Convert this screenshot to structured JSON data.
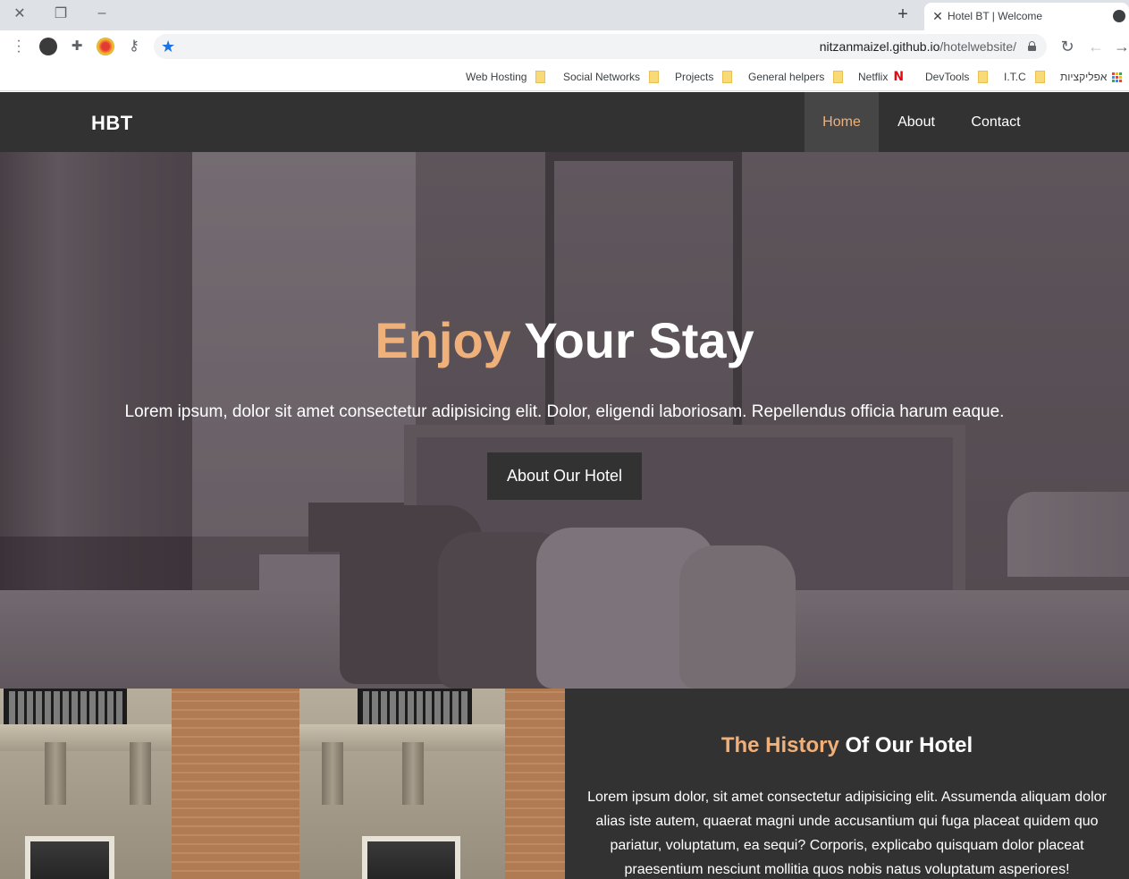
{
  "browser": {
    "tab": {
      "title": "Hotel BT | Welcome"
    },
    "url": {
      "host": "nitzanmaizel.github.io",
      "path": "/hotelwebsite/"
    },
    "bookmarks": [
      {
        "label": "Web Hosting",
        "icon": "folder-icon"
      },
      {
        "label": "Social Networks",
        "icon": "folder-icon"
      },
      {
        "label": "Projects",
        "icon": "folder-icon"
      },
      {
        "label": "General helpers",
        "icon": "folder-icon"
      },
      {
        "label": "Netflix",
        "icon": "netflix-icon"
      },
      {
        "label": "DevTools",
        "icon": "folder-icon"
      },
      {
        "label": "I.T.C",
        "icon": "folder-icon"
      },
      {
        "label": "אפליקציות",
        "icon": "apps-icon"
      }
    ]
  },
  "navbar": {
    "brand": "HBT",
    "links": [
      "Home",
      "About",
      "Contact"
    ],
    "active": "Home"
  },
  "hero": {
    "title_accent": "Enjoy",
    "title_rest": " Your Stay",
    "text": "Lorem ipsum, dolor sit amet consectetur adipisicing elit. Dolor, eligendi laboriosam. Repellendus officia harum eaque.",
    "button": "About Our Hotel"
  },
  "history": {
    "title_accent": "The History",
    "title_rest": " Of Our Hotel",
    "text": "Lorem ipsum dolor, sit amet consectetur adipisicing elit. Assumenda aliquam dolor alias iste autem, quaerat magni unde accusantium qui fuga placeat quidem quo pariatur, voluptatum, ea sequi? Corporis, explicabo quisquam dolor placeat praesentium nesciunt mollitia quos nobis natus voluptatum asperiores!"
  },
  "colors": {
    "accent": "#f0b07a",
    "dark": "#333232"
  }
}
